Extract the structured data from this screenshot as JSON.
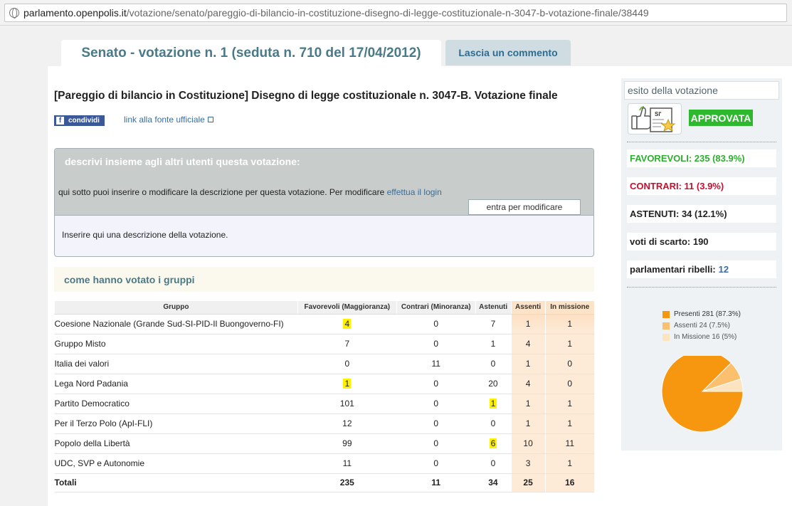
{
  "browser": {
    "url_host": "parlamento.openpolis.it",
    "url_path": "/votazione/senato/pareggio-di-bilancio-in-costituzione-disegno-di-legge-costituzionale-n-3047-b-votazione-finale/38449"
  },
  "tabs": {
    "main": "Senato - votazione n. 1 (seduta n. 710 del 17/04/2012)",
    "comment": "Lascia un commento"
  },
  "title": "[Pareggio di bilancio in Costituzione] Disegno di legge costituzionale n. 3047-B. Votazione finale",
  "share": {
    "fb_letter": "f",
    "label": "condividi",
    "source_link": "link alla fonte ufficiale"
  },
  "description": {
    "heading": "descrivi insieme agli altri utenti questa votazione:",
    "info": "qui sotto puoi inserire o modificare la descrizione per questa votazione. Per modificare",
    "login_link": "effettua il login",
    "edit_button": "entra per modificare",
    "placeholder": "Inserire qui una descrizione della votazione."
  },
  "groups_heading": "come hanno votato i gruppi",
  "table": {
    "headers": [
      "Gruppo",
      "Favorevoli (Maggioranza)",
      "Contrari (Minoranza)",
      "Astenuti",
      "Assenti",
      "In missione"
    ],
    "rows": [
      {
        "gruppo": "Coesione Nazionale (Grande Sud-SI-PID-Il Buongoverno-FI)",
        "fav": "4",
        "con": "0",
        "ast": "7",
        "ass": "1",
        "mis": "1"
      },
      {
        "gruppo": "Gruppo Misto",
        "fav": "7",
        "con": "0",
        "ast": "1",
        "ass": "4",
        "mis": "1"
      },
      {
        "gruppo": "Italia dei valori",
        "fav": "0",
        "con": "11",
        "ast": "0",
        "ass": "1",
        "mis": "0"
      },
      {
        "gruppo": "Lega Nord Padania",
        "fav": "1",
        "con": "0",
        "ast": "20",
        "ass": "4",
        "mis": "0"
      },
      {
        "gruppo": "Partito Democratico",
        "fav": "101",
        "con": "0",
        "ast": "1",
        "ass": "1",
        "mis": "1"
      },
      {
        "gruppo": "Per il Terzo Polo (ApI-FLI)",
        "fav": "12",
        "con": "0",
        "ast": "0",
        "ass": "1",
        "mis": "1"
      },
      {
        "gruppo": "Popolo della Libertà",
        "fav": "99",
        "con": "0",
        "ast": "6",
        "ass": "10",
        "mis": "11"
      },
      {
        "gruppo": "UDC, SVP e Autonomie",
        "fav": "11",
        "con": "0",
        "ast": "0",
        "ass": "3",
        "mis": "1"
      }
    ],
    "totals": {
      "label": "Totali",
      "fav": "235",
      "con": "11",
      "ast": "34",
      "ass": "25",
      "mis": "16"
    }
  },
  "sidebar": {
    "esito_label": "esito della votazione",
    "icon_text": "SI'",
    "result": "APPROVATA",
    "favorevoli": "FAVOREVOLI: 235 (83.9%)",
    "contrari": "CONTRARI: 11 (3.9%)",
    "astenuti": "ASTENUTI: 34 (12.1%)",
    "scarto": "voti di scarto: 190",
    "ribelli_label": "parlamentari ribelli:",
    "ribelli_value": "12",
    "colors": {
      "approved": "#2eb82e",
      "favorevoli": "#2eae2e",
      "contrari": "#c8102e"
    }
  },
  "chart_data": {
    "type": "pie",
    "series": [
      {
        "name": "Presenti 281 (87.3%)",
        "value": 281,
        "color": "#f7960f"
      },
      {
        "name": "Assenti 24 (7.5%)",
        "value": 24,
        "color": "#fbc06e"
      },
      {
        "name": "In Missione 16 (5%)",
        "value": 16,
        "color": "#fde4c1"
      }
    ],
    "legend": "top-left"
  }
}
